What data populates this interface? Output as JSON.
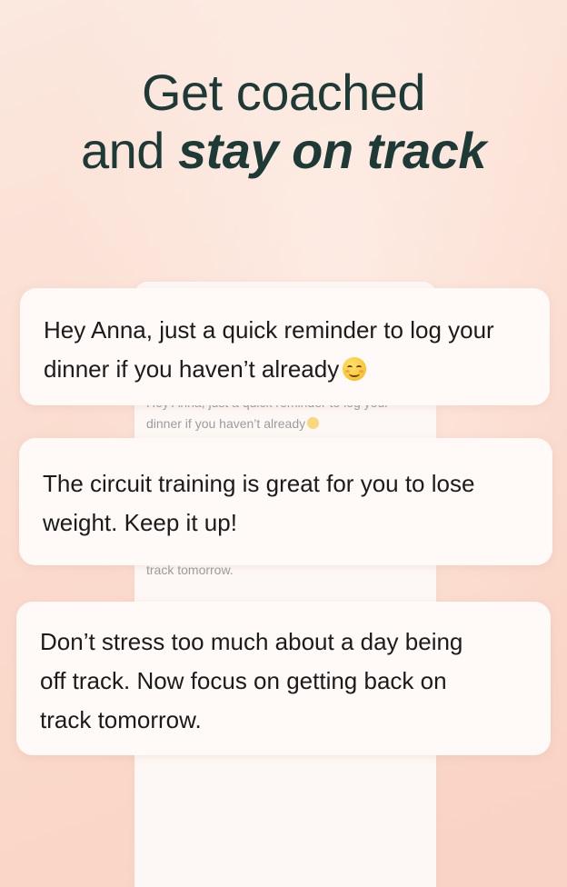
{
  "headline": {
    "line1": "Get coached",
    "line2_prefix": "and ",
    "line2_emphasis": "stay on track"
  },
  "ghost_messages": {
    "line_a": "Hey Anna, just a quick reminder to log your",
    "line_b": "dinner if you haven’t already",
    "line_c": "track tomorrow."
  },
  "messages": [
    {
      "lines": [
        "Hey Anna, just a quick reminder to log your",
        "dinner if you haven’t already"
      ],
      "emoji": "smiling-face-emoji"
    },
    {
      "lines": [
        "The circuit training is great for you to lose",
        "weight. Keep it up!"
      ]
    },
    {
      "lines": [
        "Don’t stress too much about a day being",
        "off track. Now focus on getting back on",
        "track tomorrow."
      ]
    }
  ],
  "colors": {
    "headline": "#1d3a37",
    "background_top": "#fbe8df",
    "background_bottom": "#f9d3c3",
    "card": "#fffaf7",
    "emoji": "#f9c22e"
  }
}
